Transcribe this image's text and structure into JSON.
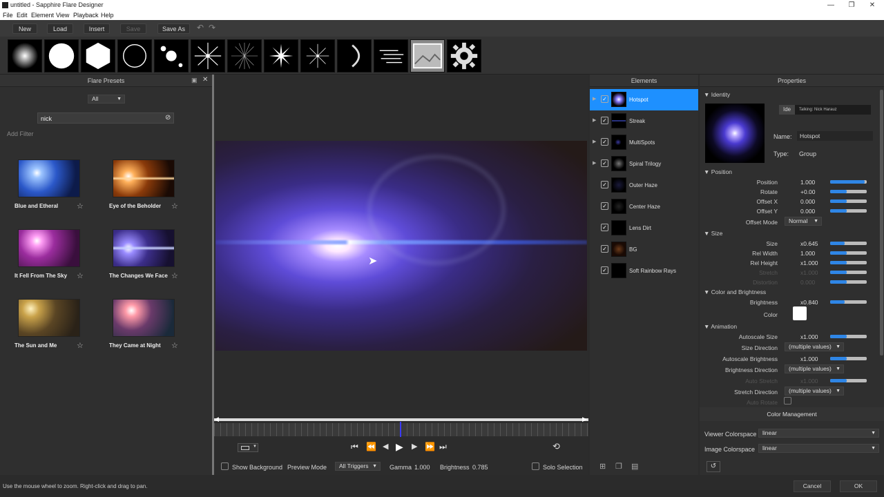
{
  "window": {
    "title": "untitled - Sapphire Flare Designer",
    "min": "—",
    "max": "❐",
    "close": "✕"
  },
  "menu": [
    "File",
    "Edit",
    "Element",
    "View",
    "Playback",
    "Help"
  ],
  "toolbar": {
    "new": "New",
    "load": "Load",
    "insert": "Insert",
    "save": "Save",
    "save_as": "Save As",
    "undo": "↶",
    "redo": "↷"
  },
  "palette_icons": [
    "glow-icon",
    "circle-icon",
    "hexagon-icon",
    "ring-icon",
    "multi-spots-icon",
    "star-icon",
    "rays-icon",
    "spikes-icon",
    "sparkle-icon",
    "arc-icon",
    "streaks-icon",
    "image-icon",
    "gear-icon"
  ],
  "presets_panel": {
    "title": "Flare Presets",
    "filter_value": "All",
    "search_value": "nick",
    "add_filter": "Add Filter",
    "items": [
      {
        "name": "Blue and Etheral",
        "star": "☆"
      },
      {
        "name": "Eye of the Beholder",
        "star": "☆"
      },
      {
        "name": "It Fell From The Sky",
        "star": "☆"
      },
      {
        "name": "The Changes We Face",
        "star": "☆"
      },
      {
        "name": "The Sun and Me",
        "star": "☆"
      },
      {
        "name": "They Came at Night",
        "star": "☆"
      }
    ]
  },
  "viewer": {
    "show_background": "Show Background",
    "preview_mode": "Preview Mode",
    "preview_value": "All Triggers",
    "gamma_label": "Gamma",
    "gamma_value": "1.000",
    "brightness_label": "Brightness",
    "brightness_value": "0.785",
    "solo_selection": "Solo Selection"
  },
  "elements_panel": {
    "title": "Elements",
    "items": [
      {
        "name": "Hotspot",
        "expandable": true,
        "selected": true
      },
      {
        "name": "Streak",
        "expandable": true
      },
      {
        "name": "MultiSpots",
        "expandable": true
      },
      {
        "name": "Spiral Trilogy",
        "expandable": true
      },
      {
        "name": "Outer Haze",
        "expandable": false
      },
      {
        "name": "Center Haze",
        "expandable": false
      },
      {
        "name": "Lens Dirt",
        "expandable": false
      },
      {
        "name": "BG",
        "expandable": false
      },
      {
        "name": "Soft Rainbow Rays",
        "expandable": false
      }
    ]
  },
  "properties": {
    "title": "Properties",
    "identity": {
      "section": "Identity",
      "tab": "Ide",
      "tooltip": "Talking: Nick Harauz",
      "name_label": "Name:",
      "name_value": "Hotspot",
      "type_label": "Type:",
      "type_value": "Group"
    },
    "position": {
      "section": "Position",
      "rows": [
        {
          "label": "Position",
          "value": "1.000",
          "fill": 0.95
        },
        {
          "label": "Rotate",
          "value": "+0.00",
          "fill": 0.45
        },
        {
          "label": "Offset X",
          "value": "0.000",
          "fill": 0.45
        },
        {
          "label": "Offset Y",
          "value": "0.000",
          "fill": 0.45
        }
      ],
      "offset_mode_label": "Offset Mode",
      "offset_mode_value": "Normal"
    },
    "size": {
      "section": "Size",
      "rows": [
        {
          "label": "Size",
          "value": "x0.645",
          "fill": 0.4,
          "dim": false
        },
        {
          "label": "Rel Width",
          "value": "1.000",
          "fill": 0.45,
          "dim": false
        },
        {
          "label": "Rel Height",
          "value": "x1.000",
          "fill": 0.45,
          "dim": false
        },
        {
          "label": "Stretch",
          "value": "x1.000",
          "fill": 0.45,
          "dim": true
        },
        {
          "label": "Distortion",
          "value": "0.000",
          "fill": 0.45,
          "dim": true
        }
      ]
    },
    "color": {
      "section": "Color and Brightness",
      "brightness_label": "Brightness",
      "brightness_value": "x0.840",
      "brightness_fill": 0.4,
      "color_label": "Color",
      "color_value": "#ffffff"
    },
    "animation": {
      "section": "Animation",
      "autoscale_size_label": "Autoscale Size",
      "autoscale_size_value": "x1.000",
      "size_dir_label": "Size Direction",
      "size_dir_value": "(multiple values)",
      "autoscale_brightness_label": "Autoscale Brightness",
      "autoscale_brightness_value": "x1.000",
      "brightness_dir_label": "Brightness Direction",
      "brightness_dir_value": "(multiple values)",
      "auto_stretch_label": "Auto Stretch",
      "auto_stretch_value": "x1.000",
      "stretch_dir_label": "Stretch Direction",
      "stretch_dir_value": "(multiple values)",
      "auto_rotate_label": "Auto Rotate"
    },
    "color_management": {
      "title": "Color Management",
      "viewer_label": "Viewer Colorspace",
      "viewer_value": "linear",
      "image_label": "Image Colorspace",
      "image_value": "linear"
    }
  },
  "status": {
    "hint": "Use the mouse wheel to zoom.  Right-click and drag to pan.",
    "cancel": "Cancel",
    "ok": "OK"
  }
}
